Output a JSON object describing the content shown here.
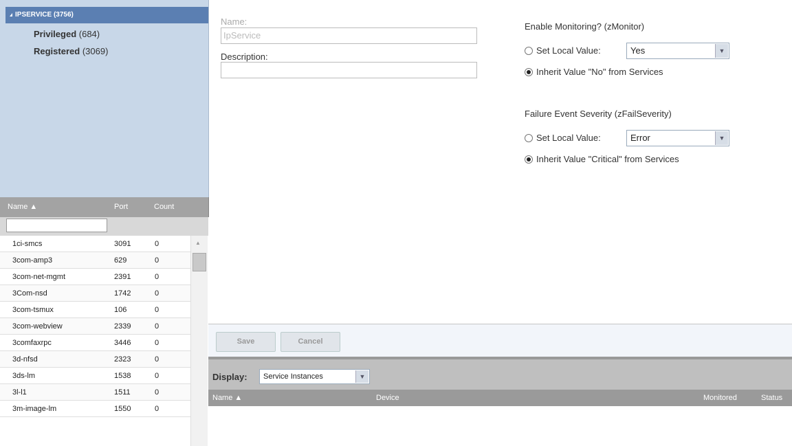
{
  "tree": {
    "root": "IPSERVICE (3756)",
    "children": [
      {
        "name": "Privileged",
        "count": "(684)"
      },
      {
        "name": "Registered",
        "count": "(3069)"
      }
    ]
  },
  "grid": {
    "columns": {
      "name": "Name ▲",
      "port": "Port",
      "count": "Count"
    },
    "filter_value": "",
    "rows": [
      {
        "name": "1ci-smcs",
        "port": "3091",
        "count": "0"
      },
      {
        "name": "3com-amp3",
        "port": "629",
        "count": "0"
      },
      {
        "name": "3com-net-mgmt",
        "port": "2391",
        "count": "0"
      },
      {
        "name": "3Com-nsd",
        "port": "1742",
        "count": "0"
      },
      {
        "name": "3com-tsmux",
        "port": "106",
        "count": "0"
      },
      {
        "name": "3com-webview",
        "port": "2339",
        "count": "0"
      },
      {
        "name": "3comfaxrpc",
        "port": "3446",
        "count": "0"
      },
      {
        "name": "3d-nfsd",
        "port": "2323",
        "count": "0"
      },
      {
        "name": "3ds-lm",
        "port": "1538",
        "count": "0"
      },
      {
        "name": "3l-l1",
        "port": "1511",
        "count": "0"
      },
      {
        "name": "3m-image-lm",
        "port": "1550",
        "count": "0"
      }
    ]
  },
  "form": {
    "name_label": "Name:",
    "name_value": "IpService",
    "description_label": "Description:",
    "description_value": "",
    "monitor": {
      "title": "Enable Monitoring? (zMonitor)",
      "set_local_label": "Set Local Value:",
      "select_value": "Yes",
      "inherit_label": "Inherit Value \"No\" from Services"
    },
    "severity": {
      "title": "Failure Event Severity (zFailSeverity)",
      "set_local_label": "Set Local Value:",
      "select_value": "Error",
      "inherit_label": "Inherit Value \"Critical\" from Services"
    }
  },
  "buttons": {
    "save": "Save",
    "cancel": "Cancel"
  },
  "display": {
    "label": "Display:",
    "selected": "Service Instances",
    "columns": {
      "name": "Name ▲",
      "device": "Device",
      "monitored": "Monitored",
      "status": "Status"
    }
  }
}
